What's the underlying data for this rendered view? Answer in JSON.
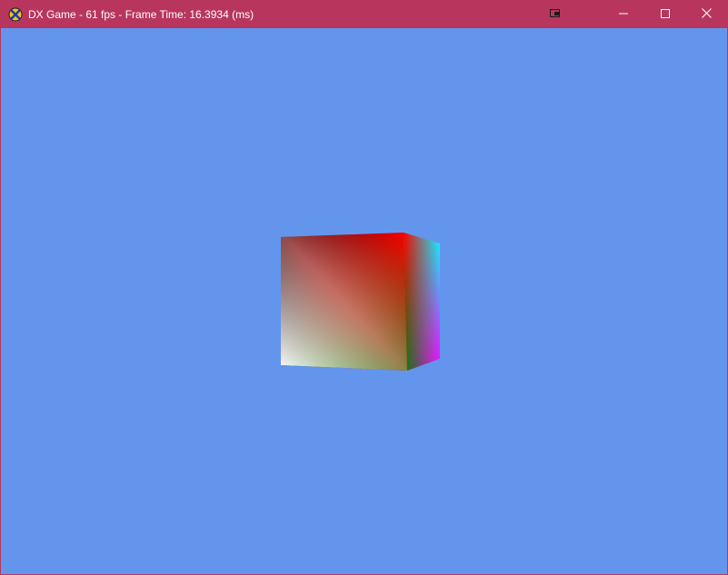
{
  "window": {
    "title": "DX Game - 61 fps - Frame Time: 16.3934 (ms)",
    "titlebar_color": "#b8365e",
    "clear_color": "#6495ed"
  },
  "icons": {
    "app": "directx-x-icon",
    "extra": "window-snap-icon",
    "minimize": "minimize-icon",
    "maximize": "maximize-icon",
    "close": "close-icon"
  },
  "scene": {
    "object": "rotating-color-cube",
    "face_colors": {
      "front_top_left": "#000000",
      "front_top_right": "#ff0000",
      "front_bottom_left": "#ffffff",
      "front_bottom_right": "#008000",
      "side_top": "#00ffff",
      "side_bottom": "#ff00ff"
    }
  }
}
